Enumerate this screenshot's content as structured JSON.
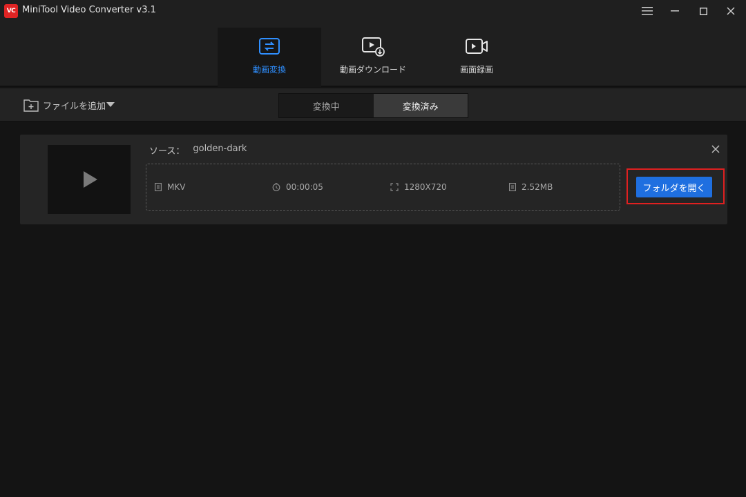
{
  "app": {
    "logo_text": "VC",
    "title": "MiniTool Video Converter v3.1"
  },
  "window_controls": [
    "menu-icon",
    "minimize-icon",
    "maximize-icon",
    "close-icon"
  ],
  "nav": {
    "tabs": [
      {
        "label": "動画変換",
        "icon": "convert-icon",
        "active": true
      },
      {
        "label": "動画ダウンロード",
        "icon": "download-video-icon",
        "active": false
      },
      {
        "label": "画面録画",
        "icon": "record-screen-icon",
        "active": false
      }
    ]
  },
  "toolbar": {
    "add_file_label": "ファイルを追加",
    "segments": [
      {
        "label": "変換中",
        "active": false
      },
      {
        "label": "変換済み",
        "active": true
      }
    ]
  },
  "task": {
    "source_label": "ソース：",
    "source_value": "golden-dark",
    "format": "MKV",
    "duration": "00:00:05",
    "resolution": "1280X720",
    "size": "2.52MB",
    "open_folder_label": "フォルダを開く"
  },
  "colors": {
    "accent": "#2f8fff",
    "button": "#1f6fe0",
    "highlight": "#e02020",
    "logo": "#e02424"
  }
}
